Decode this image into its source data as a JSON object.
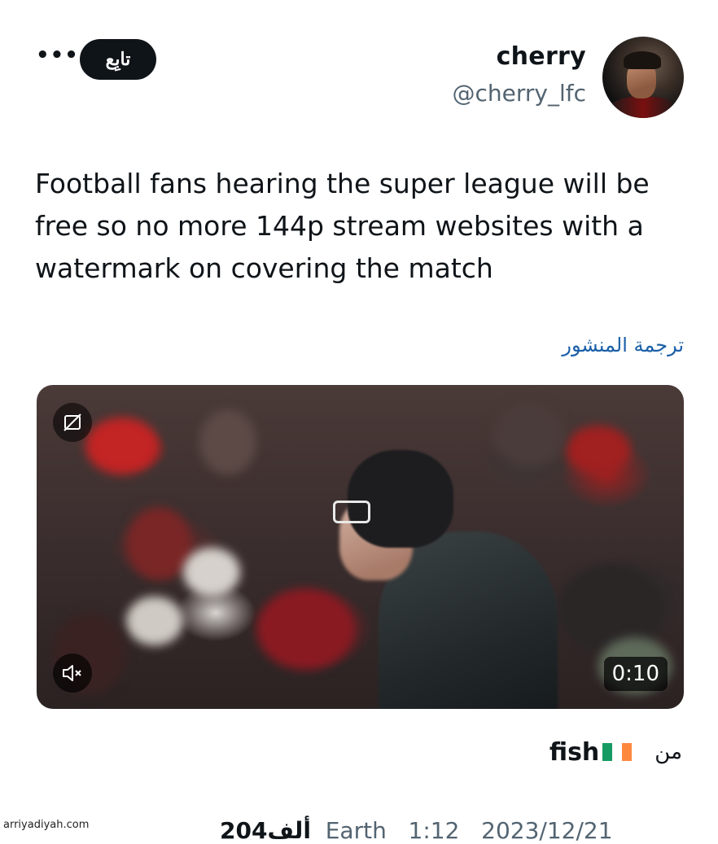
{
  "author": {
    "display_name": "cherry",
    "handle": "@cherry_lfc"
  },
  "header": {
    "follow_label": "تابِع",
    "more_icon": "more-horizontal-icon"
  },
  "tweet": {
    "text": "Football fans hearing the super league will be free so no more 144p stream websites with a watermark on covering the match",
    "translate_label": "ترجمة المنشور"
  },
  "media": {
    "duration": "0:10",
    "alt_icon": "no-alt-text-icon",
    "mute_icon": "muted-speaker-icon"
  },
  "source": {
    "from_label": "من",
    "name": "fish",
    "flag_colors": [
      "#169b62",
      "#ffffff",
      "#ff883e"
    ]
  },
  "meta": {
    "count": "204",
    "count_suffix": "ألف",
    "location_partial": "Earth",
    "time_partial": "1:12",
    "date_partial": "2023/12/21"
  },
  "watermark": "arriyadiyah.com"
}
